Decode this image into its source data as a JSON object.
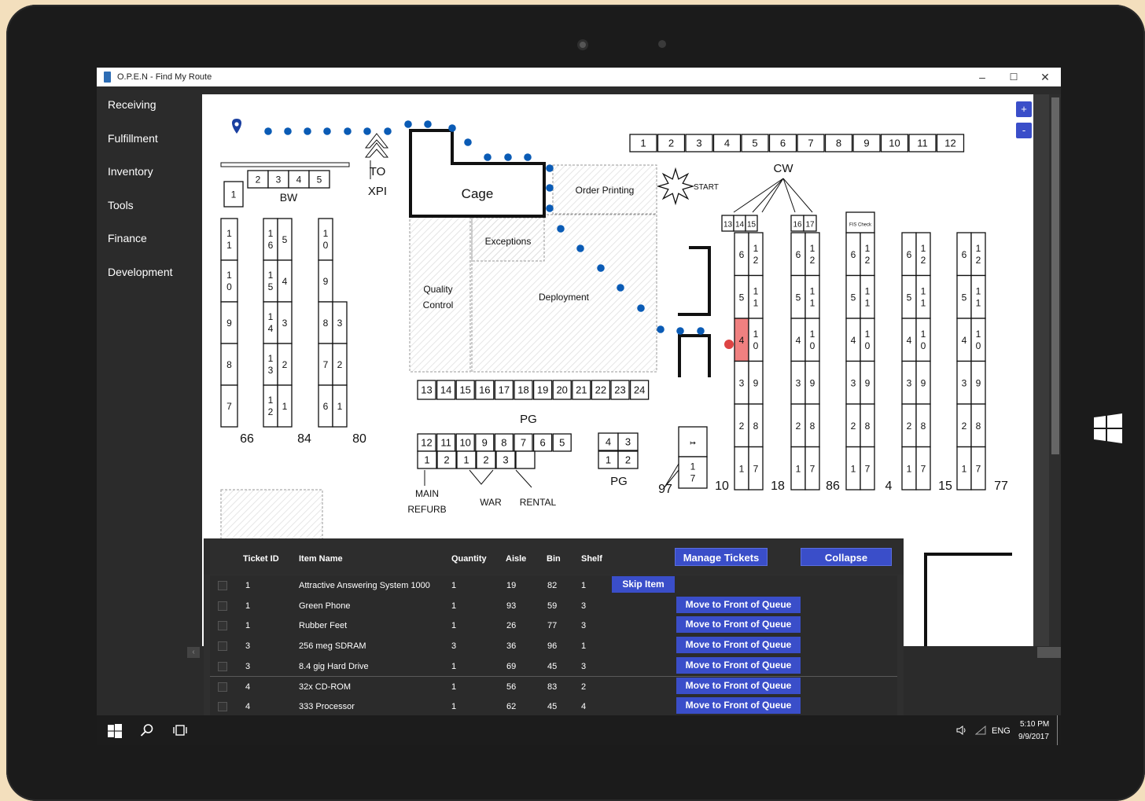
{
  "window": {
    "title": "O.P.E.N - Find My Route",
    "minimize": "–",
    "maximize": "☐",
    "close": "✕"
  },
  "sidebar": {
    "items": [
      {
        "label": "Receiving"
      },
      {
        "label": "Fulfillment"
      },
      {
        "label": "Inventory"
      },
      {
        "label": "Tools"
      },
      {
        "label": "Finance"
      },
      {
        "label": "Development"
      }
    ]
  },
  "map": {
    "zoom_in": "+",
    "zoom_out": "-",
    "labels": {
      "to_xpi": "TO\nXPI",
      "bw": "BW",
      "cage": "Cage",
      "order_printing": "Order Printing",
      "start": "START",
      "cw": "CW",
      "exceptions": "Exceptions",
      "quality_control": "Quality Control",
      "deployment": "Deployment",
      "pg": "PG",
      "pg2": "PG",
      "main_refurb": "MAIN REFURB",
      "war": "WAR",
      "rental": "RENTAL",
      "fis_check": "FIS Check"
    },
    "cw_top_bins": [
      "1",
      "2",
      "3",
      "4",
      "5",
      "6",
      "7",
      "8",
      "9",
      "10",
      "11",
      "12"
    ],
    "bw_bins": [
      "2",
      "3",
      "4",
      "5"
    ],
    "bw_single": "1",
    "pg_row": [
      "13",
      "14",
      "15",
      "16",
      "17",
      "18",
      "19",
      "20",
      "21",
      "22",
      "23",
      "24"
    ],
    "bottom_row_top": [
      "12",
      "11",
      "10",
      "9",
      "8",
      "7",
      "6",
      "5"
    ],
    "bottom_row_bottom": [
      "1",
      "2",
      "1",
      "2",
      "3",
      ""
    ],
    "pg2_top": [
      "4",
      "3"
    ],
    "pg2_bottom": [
      "1",
      "2"
    ],
    "aisle_numbers": [
      "66",
      "84",
      "80",
      "97",
      "10",
      "18",
      "86",
      "4",
      "15",
      "77"
    ],
    "cw_header_bins": [
      [
        "13",
        "14",
        "15"
      ],
      [
        "16",
        "17"
      ]
    ],
    "highlight_bin": "4",
    "route_color": "#0a5bb5",
    "highlight_color": "#f08080"
  },
  "tickets": {
    "columns": [
      "Ticket ID",
      "Item Name",
      "Quantity",
      "Aisle",
      "Bin",
      "Shelf"
    ],
    "manage_label": "Manage Tickets",
    "collapse_label": "Collapse",
    "rows": [
      {
        "id": "1",
        "name": "Attractive Answering System 1000",
        "qty": "1",
        "aisle": "19",
        "bin": "82",
        "shelf": "1",
        "action": "Skip Item"
      },
      {
        "id": "1",
        "name": "Green Phone",
        "qty": "1",
        "aisle": "93",
        "bin": "59",
        "shelf": "3",
        "action": "Move to Front of Queue"
      },
      {
        "id": "1",
        "name": "Rubber Feet",
        "qty": "1",
        "aisle": "26",
        "bin": "77",
        "shelf": "3",
        "action": "Move to Front of Queue"
      },
      {
        "id": "3",
        "name": "256 meg SDRAM",
        "qty": "3",
        "aisle": "36",
        "bin": "96",
        "shelf": "1",
        "action": "Move to Front of Queue"
      },
      {
        "id": "3",
        "name": "8.4 gig Hard Drive",
        "qty": "1",
        "aisle": "69",
        "bin": "45",
        "shelf": "3",
        "action": "Move to Front of Queue"
      },
      {
        "id": "4",
        "name": "32x CD-ROM",
        "qty": "1",
        "aisle": "56",
        "bin": "83",
        "shelf": "2",
        "action": "Move to Front of Queue"
      },
      {
        "id": "4",
        "name": "333 Processor",
        "qty": "1",
        "aisle": "62",
        "bin": "45",
        "shelf": "4",
        "action": "Move to Front of Queue"
      }
    ]
  },
  "taskbar": {
    "lang": "ENG",
    "time": "5:10 PM",
    "date": "9/9/2017"
  }
}
